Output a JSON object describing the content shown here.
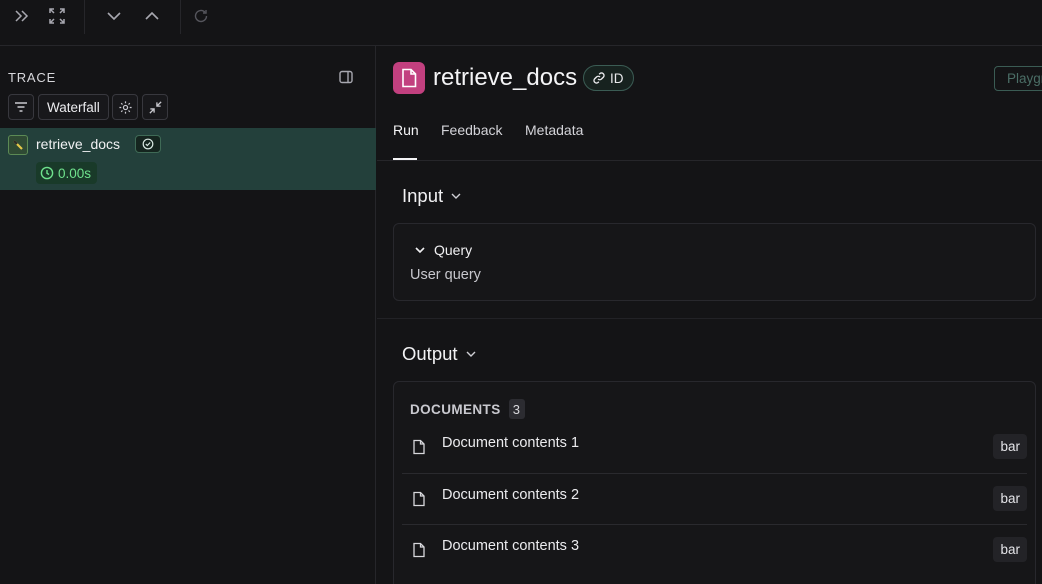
{
  "trace_panel": {
    "title": "TRACE",
    "view_mode": "Waterfall",
    "run": {
      "name": "retrieve_docs",
      "latency": "0.00s"
    }
  },
  "run_detail": {
    "title": "retrieve_docs",
    "id_label": "ID",
    "play_label": "Playground",
    "tabs": [
      {
        "label": "Run"
      },
      {
        "label": "Feedback"
      },
      {
        "label": "Metadata"
      }
    ],
    "input": {
      "heading": "Input",
      "field_label": "Query",
      "field_value": "User query"
    },
    "output": {
      "heading": "Output",
      "documents_label": "DOCUMENTS",
      "documents_count": "3",
      "documents": [
        {
          "text": "Document contents 1",
          "tag": "bar"
        },
        {
          "text": "Document contents 2",
          "tag": "bar"
        },
        {
          "text": "Document contents 3",
          "tag": "bar"
        }
      ]
    }
  },
  "colors": {
    "background": "#141416",
    "selected_row": "#23403b",
    "latency_text": "#6fe28d",
    "run_icon_bg": "#c2407f"
  }
}
